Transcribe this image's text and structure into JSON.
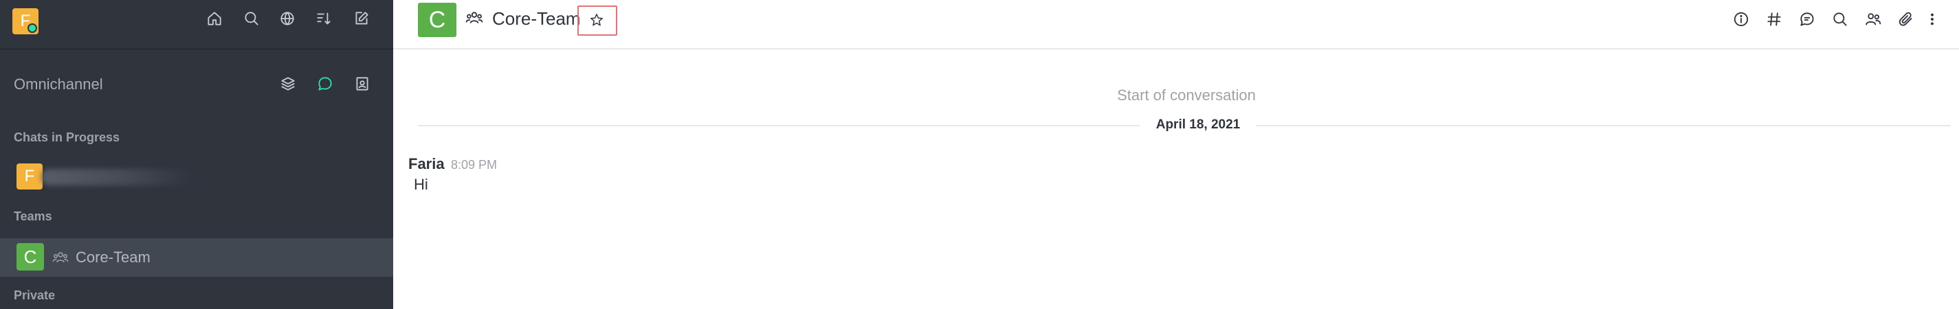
{
  "sidebar": {
    "user_avatar_letter": "F",
    "header_icons": [
      "home-icon",
      "search-icon",
      "directory-icon",
      "sort-icon",
      "create-new-icon"
    ],
    "omnichannel": {
      "label": "Omnichannel",
      "icons": [
        "queue-icon",
        "omnichannel-chat-icon",
        "contact-center-icon"
      ],
      "active_color": "#2de0a5"
    },
    "sections": {
      "chats_in_progress": "Chats in Progress",
      "teams": "Teams",
      "private": "Private"
    },
    "chat_item": {
      "avatar_letter": "F"
    },
    "team_item": {
      "avatar_letter": "C",
      "label": "Core-Team",
      "icon": "team-icon"
    },
    "colors": {
      "background": "#2f343d",
      "selected": "#414852",
      "avatar_yellow": "#f5b33b",
      "avatar_green": "#5bb04a"
    }
  },
  "room": {
    "avatar_letter": "C",
    "title": "Core-Team",
    "type_icon": "team-icon",
    "favorite_icon": "star-icon",
    "header_icons": [
      "info-icon",
      "channels-icon",
      "discussion-icon",
      "search-icon",
      "members-icon",
      "attachment-icon",
      "kebab-icon"
    ]
  },
  "conversation": {
    "start_text": "Start of conversation",
    "date_separator": "April 18, 2021",
    "messages": [
      {
        "author": "Faria",
        "time": "8:09 PM",
        "text": "Hi"
      }
    ]
  }
}
